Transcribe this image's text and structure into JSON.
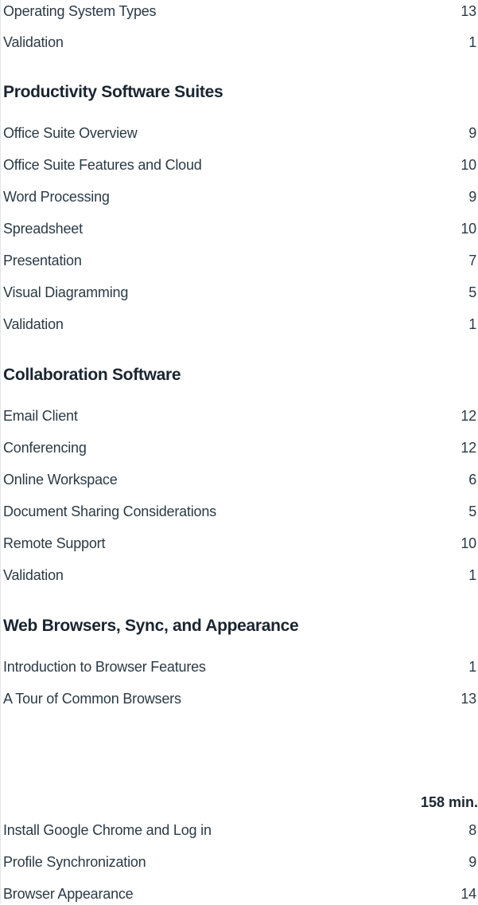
{
  "section0": {
    "items": [
      {
        "label": "Operating System Types",
        "count": "13"
      },
      {
        "label": "Validation",
        "count": "1"
      }
    ]
  },
  "section1": {
    "title": "Productivity Software Suites",
    "items": [
      {
        "label": "Office Suite Overview",
        "count": "9"
      },
      {
        "label": "Office Suite Features and Cloud",
        "count": "10"
      },
      {
        "label": "Word Processing",
        "count": "9"
      },
      {
        "label": "Spreadsheet",
        "count": "10"
      },
      {
        "label": "Presentation",
        "count": "7"
      },
      {
        "label": "Visual Diagramming",
        "count": "5"
      },
      {
        "label": "Validation",
        "count": "1"
      }
    ]
  },
  "section2": {
    "title": "Collaboration Software",
    "items": [
      {
        "label": "Email Client",
        "count": "12"
      },
      {
        "label": "Conferencing",
        "count": "12"
      },
      {
        "label": "Online Workspace",
        "count": "6"
      },
      {
        "label": "Document Sharing Considerations",
        "count": "5"
      },
      {
        "label": "Remote Support",
        "count": "10"
      },
      {
        "label": "Validation",
        "count": "1"
      }
    ]
  },
  "section3": {
    "title": "Web Browsers, Sync, and Appearance",
    "items": [
      {
        "label": "Introduction to Browser Features",
        "count": "1"
      },
      {
        "label": "A Tour of Common Browsers",
        "count": "13"
      }
    ],
    "total": "158 min.",
    "items_after": [
      {
        "label": "Install Google Chrome and Log in",
        "count": "8"
      },
      {
        "label": "Profile Synchronization",
        "count": "9"
      },
      {
        "label": "Browser Appearance",
        "count": "14"
      }
    ]
  }
}
